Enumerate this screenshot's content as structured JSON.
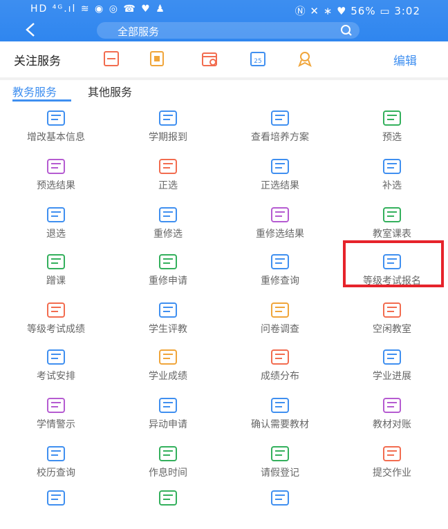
{
  "status_bar": {
    "left": "HD ⁴ᴳ.ıl ≋ ◉ ◎ ☎ ♥ ♟",
    "right": "Ⓝ ✕ ∗ ♥ 56% ▭ 3:02"
  },
  "header": {
    "search_text": "全部服务"
  },
  "favorites": {
    "title": "关注服务",
    "edit": "编辑"
  },
  "tabs": {
    "active": "教务服务",
    "other": "其他服务"
  },
  "colors": {
    "accent": "#3f8ff0",
    "highlight": "#e6232b"
  },
  "services": [
    {
      "label": "增改基本信息",
      "icon": "plus-icon",
      "color": "#3f8ff0"
    },
    {
      "label": "学期报到",
      "icon": "edit-doc-icon",
      "color": "#3f8ff0"
    },
    {
      "label": "查看培养方案",
      "icon": "edit-doc-icon",
      "color": "#3f8ff0"
    },
    {
      "label": "预选",
      "icon": "calendar-check-icon",
      "color": "#33b05c"
    },
    {
      "label": "预选结果",
      "icon": "calendar-icon",
      "color": "#b55bd1"
    },
    {
      "label": "正选",
      "icon": "calendar-check-icon",
      "color": "#f26c4f"
    },
    {
      "label": "正选结果",
      "icon": "calendar-icon",
      "color": "#3f8ff0"
    },
    {
      "label": "补选",
      "icon": "calendar-check-icon",
      "color": "#3f8ff0"
    },
    {
      "label": "退选",
      "icon": "calendar-icon",
      "color": "#3f8ff0"
    },
    {
      "label": "重修选",
      "icon": "calendar-check-icon",
      "color": "#3f8ff0"
    },
    {
      "label": "重修选结果",
      "icon": "calendar-icon",
      "color": "#b55bd1"
    },
    {
      "label": "教室课表",
      "icon": "table-icon",
      "color": "#33b05c"
    },
    {
      "label": "蹭课",
      "icon": "screen-icon",
      "color": "#33b05c"
    },
    {
      "label": "重修申请",
      "icon": "person-doc-icon",
      "color": "#33b05c"
    },
    {
      "label": "重修查询",
      "icon": "search-doc-icon",
      "color": "#3f8ff0"
    },
    {
      "label": "等级考试报名",
      "icon": "doc-icon",
      "color": "#3f8ff0"
    },
    {
      "label": "等级考试成绩",
      "icon": "shield-icon",
      "color": "#f26c4f"
    },
    {
      "label": "学生评教",
      "icon": "hand-icon",
      "color": "#3f8ff0"
    },
    {
      "label": "问卷调查",
      "icon": "question-doc-icon",
      "color": "#f0a53a"
    },
    {
      "label": "空闲教室",
      "icon": "room-icon",
      "color": "#f26c4f"
    },
    {
      "label": "考试安排",
      "icon": "person-icon",
      "color": "#3f8ff0"
    },
    {
      "label": "学业成绩",
      "icon": "award-icon",
      "color": "#f0a53a"
    },
    {
      "label": "成绩分布",
      "icon": "chart-icon",
      "color": "#f26c4f"
    },
    {
      "label": "学业进展",
      "icon": "cloud-chart-icon",
      "color": "#3f8ff0"
    },
    {
      "label": "学情警示",
      "icon": "warning-icon",
      "color": "#b55bd1"
    },
    {
      "label": "异动申请",
      "icon": "transfer-icon",
      "color": "#3f8ff0"
    },
    {
      "label": "确认需要教材",
      "icon": "list-icon",
      "color": "#3f8ff0"
    },
    {
      "label": "教材对账",
      "icon": "money-icon",
      "color": "#b55bd1"
    },
    {
      "label": "校历查询",
      "icon": "calendar-25-icon",
      "color": "#3f8ff0"
    },
    {
      "label": "作息时间",
      "icon": "clock-icon",
      "color": "#33b05c"
    },
    {
      "label": "请假登记",
      "icon": "edit-icon",
      "color": "#33b05c"
    },
    {
      "label": "提交作业",
      "icon": "submit-icon",
      "color": "#f26c4f"
    },
    {
      "label": "",
      "icon": "cancel-doc-icon",
      "color": "#3f8ff0"
    },
    {
      "label": "",
      "icon": "chat-icon",
      "color": "#33b05c"
    },
    {
      "label": "",
      "icon": "clipboard-icon",
      "color": "#3f8ff0"
    }
  ]
}
